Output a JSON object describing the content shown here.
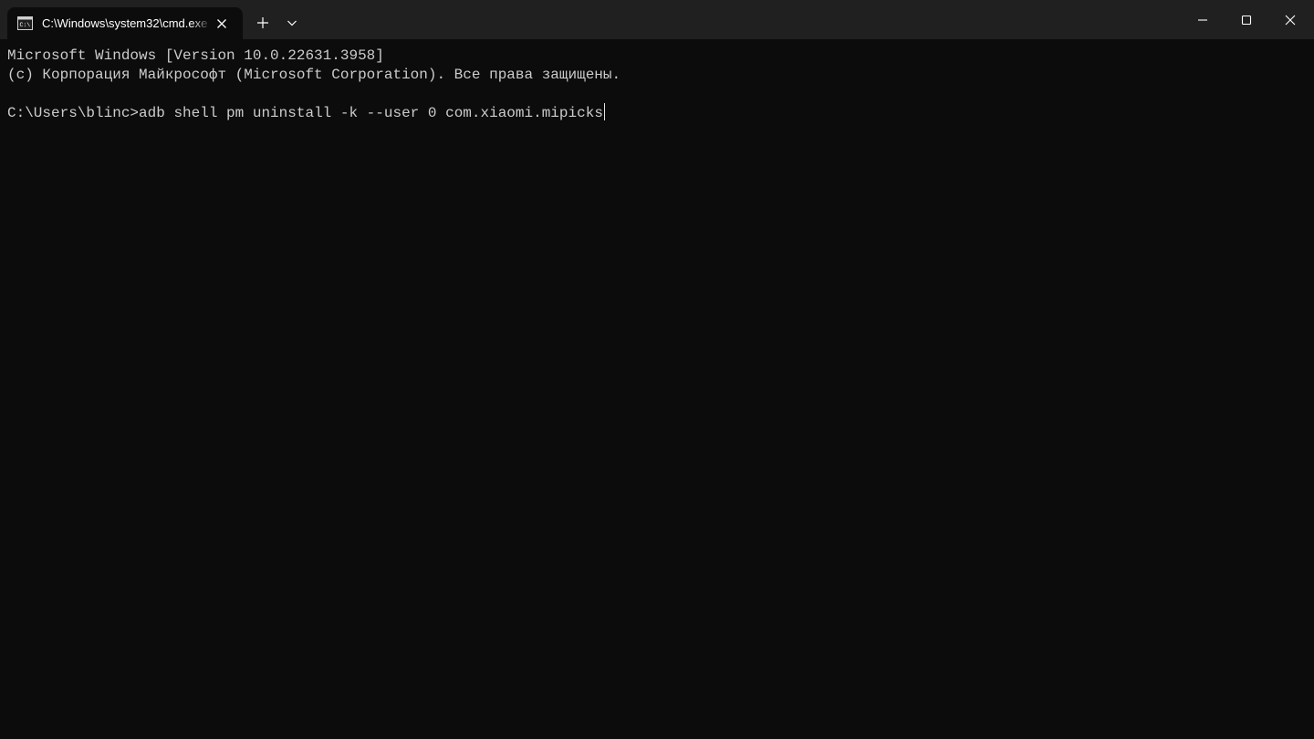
{
  "window": {
    "tab_title": "C:\\Windows\\system32\\cmd.exe",
    "tab_icon": "terminal-icon",
    "controls": {
      "new_tab_icon": "plus-icon",
      "dropdown_icon": "chevron-down-icon",
      "minimize_icon": "minimize-icon",
      "maximize_icon": "maximize-icon",
      "close_icon": "close-icon"
    }
  },
  "console": {
    "lines": [
      "Microsoft Windows [Version 10.0.22631.3958]",
      "(с) Корпорация Майкрософт (Microsoft Corporation). Все права защищены.",
      ""
    ],
    "prompt": "C:\\Users\\blinc>",
    "command": "adb shell pm uninstall -k --user 0 com.xiaomi.mipicks"
  },
  "colors": {
    "background": "#0c0c0c",
    "titlebar": "#202020",
    "text": "#cccccc"
  }
}
